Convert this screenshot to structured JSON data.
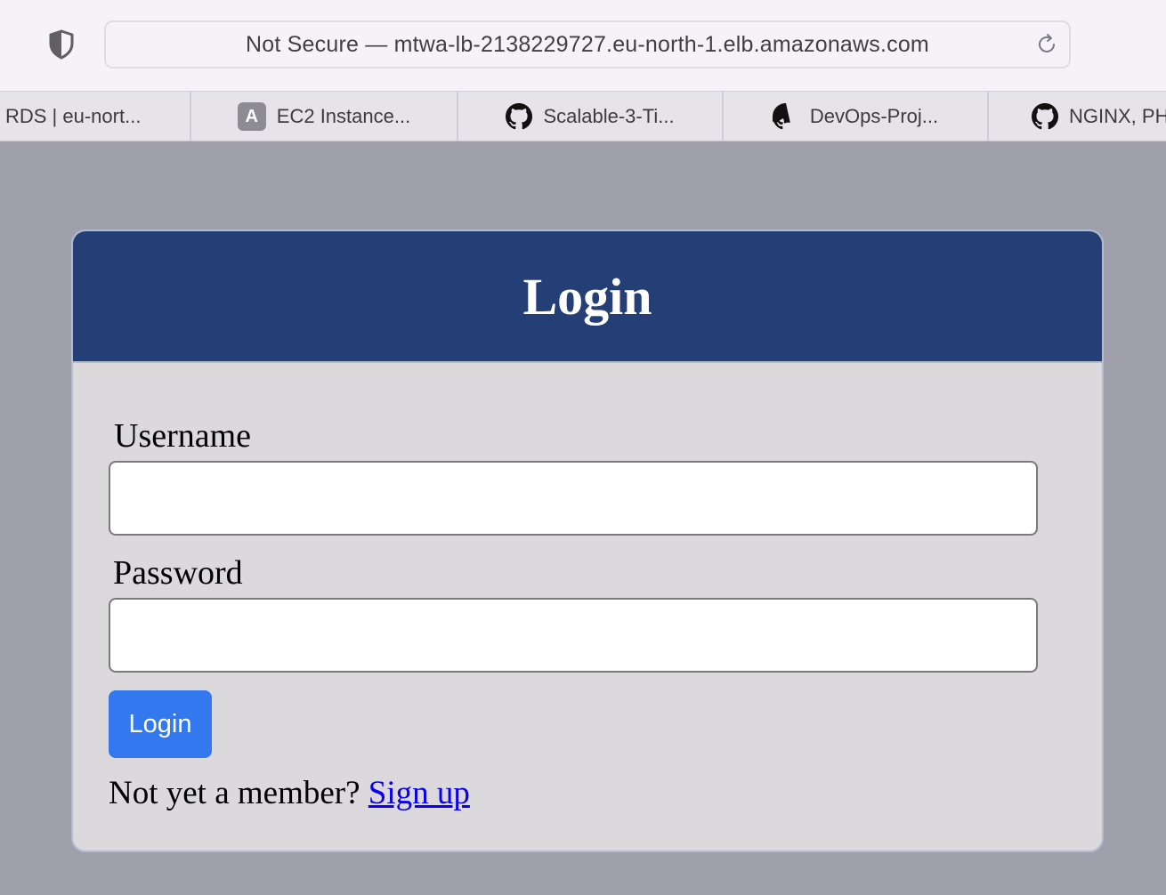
{
  "browser": {
    "address": "Not Secure — mtwa-lb-2138229727.eu-north-1.elb.amazonaws.com",
    "tabs": [
      {
        "label": "RDS | eu-nort...",
        "icon": "none"
      },
      {
        "label": "EC2 Instance...",
        "icon": "letter-a-icon",
        "icon_text": "A"
      },
      {
        "label": "Scalable-3-Ti...",
        "icon": "github-icon"
      },
      {
        "label": "DevOps-Proj...",
        "icon": "github-icon"
      },
      {
        "label": "NGINX, PH",
        "icon": "github-icon"
      }
    ]
  },
  "login_card": {
    "title": "Login",
    "username_label": "Username",
    "username_value": "",
    "password_label": "Password",
    "password_value": "",
    "submit_label": "Login",
    "signup_prompt": "Not yet a member?",
    "signup_link": "Sign up"
  },
  "colors": {
    "page_bg": "#9e9faa",
    "header_bg": "#243f76",
    "card_bg": "#dbd9db",
    "button_bg": "#3478f0",
    "link": "#0a00ee"
  }
}
